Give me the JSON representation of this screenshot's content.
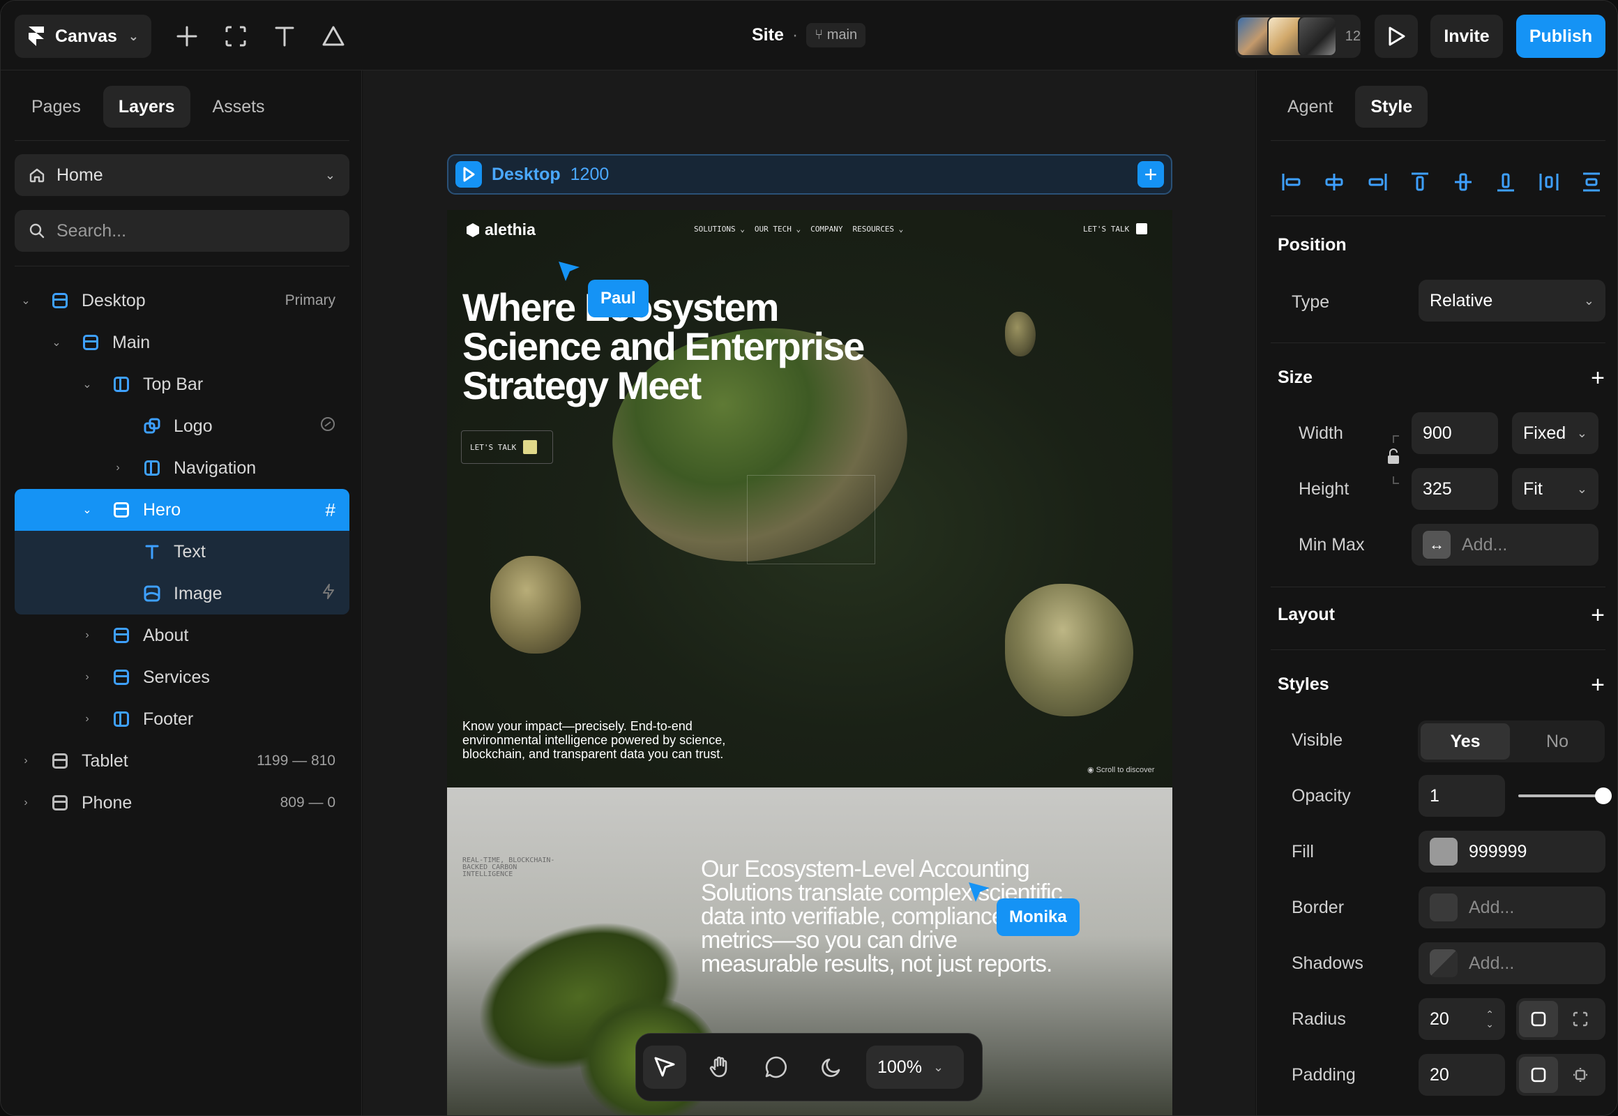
{
  "topbar": {
    "brand": "Canvas",
    "site_name": "Site",
    "branch": "main",
    "avatar_count": "12",
    "invite": "Invite",
    "publish": "Publish"
  },
  "left_panel": {
    "tabs": [
      {
        "label": "Pages",
        "active": false
      },
      {
        "label": "Layers",
        "active": true
      },
      {
        "label": "Assets",
        "active": false
      }
    ],
    "page_select": "Home",
    "search_placeholder": "Search...",
    "layers": [
      {
        "label": "Desktop",
        "meta": "Primary"
      },
      {
        "label": "Main",
        "meta": ""
      },
      {
        "label": "Top Bar",
        "meta": ""
      },
      {
        "label": "Logo",
        "meta": ""
      },
      {
        "label": "Navigation",
        "meta": ""
      },
      {
        "label": "Hero",
        "meta": "#"
      },
      {
        "label": "Text",
        "meta": ""
      },
      {
        "label": "Image",
        "meta": ""
      },
      {
        "label": "About",
        "meta": ""
      },
      {
        "label": "Services",
        "meta": ""
      },
      {
        "label": "Footer",
        "meta": ""
      },
      {
        "label": "Tablet",
        "meta": "1199 — 810"
      },
      {
        "label": "Phone",
        "meta": "809 — 0"
      }
    ]
  },
  "canvas": {
    "frame_name": "Desktop",
    "frame_width": "1200",
    "site": {
      "logo": "alethia",
      "nav": [
        "SOLUTIONS ⌄",
        "OUR TECH ⌄",
        "COMPANY",
        "RESOURCES ⌄"
      ],
      "cta": "LET'S TALK",
      "headline": "Where Ecosystem Science and Enterprise Strategy Meet",
      "button": "LET'S TALK",
      "impact": "Know your impact—precisely. End-to-end environmental intelligence powered by science, blockchain, and transparent data you can trust.",
      "scroll": "Scroll to discover",
      "realtime": "REAL-TIME, BLOCKCHAIN-BACKED CARBON INTELLIGENCE",
      "paragraph": "Our Ecosystem-Level Accounting Solutions translate complex scientific data into verifiable, compliance-ready metrics—so you can drive measurable results, not just reports."
    },
    "cursors": [
      {
        "name": "Paul"
      },
      {
        "name": "Monika"
      }
    ],
    "zoom": "100%"
  },
  "right_panel": {
    "tabs": [
      {
        "label": "Agent",
        "active": false
      },
      {
        "label": "Style",
        "active": true
      }
    ],
    "position": {
      "title": "Position",
      "type_label": "Type",
      "type_value": "Relative"
    },
    "size": {
      "title": "Size",
      "width_label": "Width",
      "width_value": "900",
      "width_mode": "Fixed",
      "height_label": "Height",
      "height_value": "325",
      "height_mode": "Fit",
      "minmax_label": "Min Max",
      "minmax_placeholder": "Add..."
    },
    "layout": {
      "title": "Layout"
    },
    "styles": {
      "title": "Styles",
      "visible_label": "Visible",
      "visible_yes": "Yes",
      "visible_no": "No",
      "opacity_label": "Opacity",
      "opacity_value": "1",
      "fill_label": "Fill",
      "fill_value": "999999",
      "fill_color": "#999999",
      "border_label": "Border",
      "border_placeholder": "Add...",
      "shadows_label": "Shadows",
      "shadows_placeholder": "Add...",
      "radius_label": "Radius",
      "radius_value": "20",
      "padding_label": "Padding",
      "padding_value": "20"
    }
  },
  "colors": {
    "accent": "#1593f5",
    "panel": "#141414",
    "field": "#262626"
  }
}
